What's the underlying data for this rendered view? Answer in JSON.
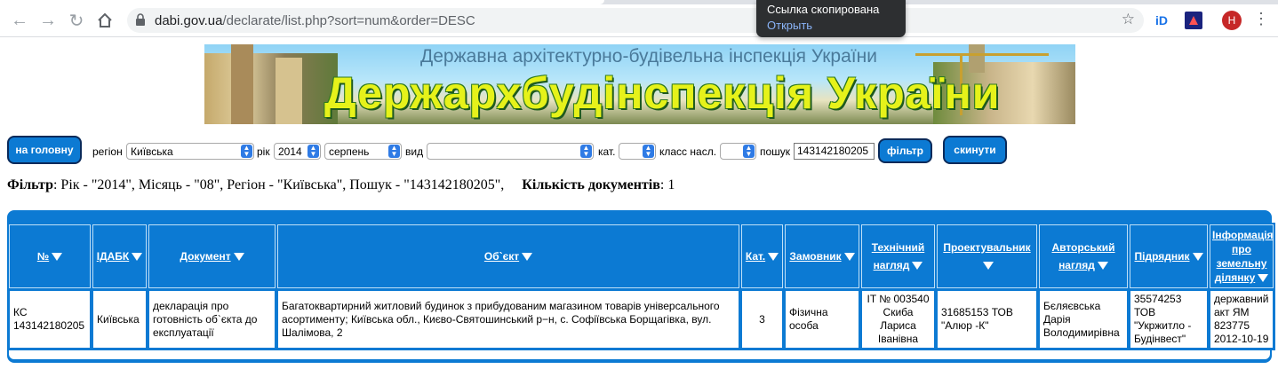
{
  "browser": {
    "url_host": "dabi.gov.ua",
    "url_path": "/declarate/list.php?sort=num&order=DESC",
    "avatar_letter": "H",
    "ext1": "iD",
    "toast": {
      "title": "Ссылка скопирована",
      "action": "Открыть"
    },
    "icons": [
      "back-arrow-icon",
      "forward-arrow-icon",
      "reload-icon",
      "home-icon",
      "lock-icon",
      "star-icon",
      "kebab-menu-icon"
    ]
  },
  "banner": {
    "subtitle": "Державна архітектурно-будівельна інспекція України",
    "title": "Держархбудінспекція України"
  },
  "filters": {
    "home_button": "на головну",
    "region_label": "регіон",
    "region_value": "Київська",
    "year_label": "рік",
    "year_value": "2014",
    "month_value": "серпень",
    "type_label": "вид",
    "type_value": "",
    "category_label": "кат.",
    "category_value": "",
    "class_label": "класс насл.",
    "class_value": "",
    "search_label": "пошук",
    "search_value": "143142180205",
    "filter_button": "фільтр",
    "reset_button": "скинути"
  },
  "summary": {
    "filter_label": "Фільтр",
    "filter_text": ": Рік - \"2014\", Місяць - \"08\", Регіон - \"Київська\", Пошук - \"143142180205\",",
    "count_label": "Кількість документів",
    "count_value": ": 1"
  },
  "table": {
    "headers": [
      "№",
      "ІДАБК",
      "Документ",
      "Об`єкт",
      "Кат.",
      "Замовник",
      "Технічний нагляд",
      "Проектувальник",
      "Авторський нагляд",
      "Підрядник",
      "Інформація про земельну ділянку"
    ],
    "rows": [
      [
        "КС 143142180205",
        "Київська",
        "декларація про готовність об`єкта до експлуатації",
        "Багатоквартирний житловий будинок з прибудованим магазином товарів універсального асортименту; Київська обл., Києво-Святошинський р−н, с. Софіївська Борщагівка, вул. Шалімова, 2",
        "3",
        "Фізична особа",
        "IT № 003540 Скиба Лариса Іванівна",
        "31685153 ТОВ \"Алюр -К\"",
        "Бєляєвська Дарія Володимирівна",
        "35574253 ТОВ \"Укржитло - Будінвест\"",
        "державний акт ЯМ 823775 2012-10-19"
      ]
    ]
  },
  "colors": {
    "accent": "#0c7ad3",
    "banner_title": "#e6f21a"
  }
}
